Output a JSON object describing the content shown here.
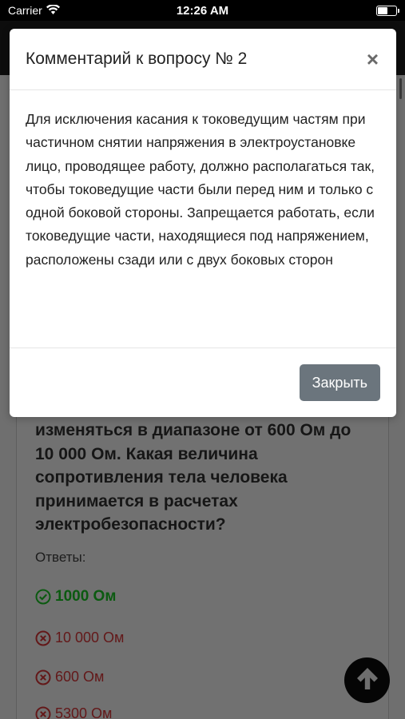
{
  "status_bar": {
    "carrier": "Carrier",
    "time": "12:26 AM"
  },
  "background": {
    "question_text": "изменяться в диапазоне от 600 Ом до 10 000 Ом. Какая величина сопротивления тела человека принимается в расчетах электробезопасности?",
    "answers_label": "Ответы:",
    "answers": [
      {
        "text": "1000 Ом",
        "status": "correct"
      },
      {
        "text": "10 000 Ом",
        "status": "wrong"
      },
      {
        "text": "600 Ом",
        "status": "wrong"
      },
      {
        "text": "5300 Ом",
        "status": "wrong"
      }
    ]
  },
  "modal": {
    "title": "Комментарий к вопросу № 2",
    "close_symbol": "×",
    "body": "Для исключения касания к токоведущим частям при частичном снятии напряжения в электроустановке лицо, проводящее работу, должно располагаться так, чтобы токоведущие части были перед ним и только с одной боковой стороны. Запрещается работать, если токоведущие части, находящиеся под напряжением, расположены сзади или с двух боковых сторон",
    "close_button": "Закрыть"
  },
  "colors": {
    "correct": "#0b5a10",
    "wrong": "#631819",
    "button": "#6b757d"
  },
  "icons": {
    "wifi": "wifi-icon",
    "battery": "battery-icon",
    "check": "check-circle-icon",
    "cross": "x-circle-icon",
    "scroll_up": "arrow-up-icon"
  }
}
